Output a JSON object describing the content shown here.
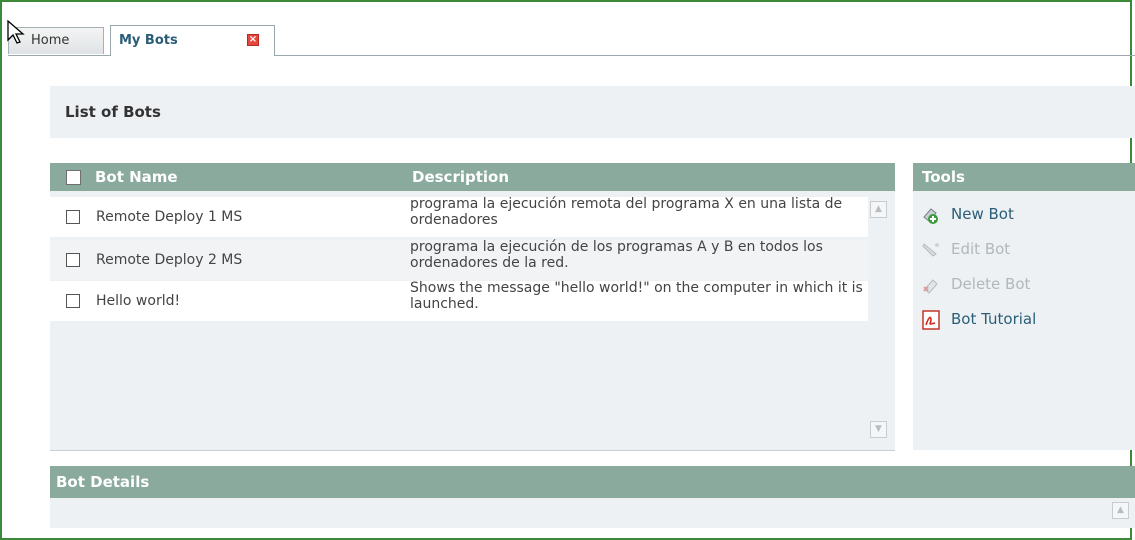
{
  "tabs": [
    {
      "label": "Home"
    },
    {
      "label": "My Bots",
      "active": true
    }
  ],
  "list_header": {
    "title": "List of Bots"
  },
  "bots_table": {
    "columns": {
      "name": "Bot Name",
      "description": "Description"
    },
    "rows": [
      {
        "name": "Remote Deploy 1 MS",
        "description": "programa la ejecución remota del programa X en una lista de ordenadores"
      },
      {
        "name": "Remote Deploy 2 MS",
        "description": "programa la ejecución de los programas A y B en todos los ordenadores de la red."
      },
      {
        "name": "Hello world!",
        "description": "Shows the message \"hello world!\" on the computer in which it is launched."
      }
    ]
  },
  "tools": {
    "title": "Tools",
    "items": [
      {
        "label": "New Bot",
        "icon": "new-bot-icon",
        "enabled": true
      },
      {
        "label": "Edit Bot",
        "icon": "edit-bot-icon",
        "enabled": false
      },
      {
        "label": "Delete Bot",
        "icon": "delete-bot-icon",
        "enabled": false
      },
      {
        "label": "Bot Tutorial",
        "icon": "pdf-icon",
        "enabled": true
      }
    ]
  },
  "details": {
    "title": "Bot Details"
  },
  "colors": {
    "header_bar": "#8aaa9e",
    "panel_bg": "#eef1f3",
    "link": "#2a5e78",
    "frame_border": "#3a8a3a"
  }
}
